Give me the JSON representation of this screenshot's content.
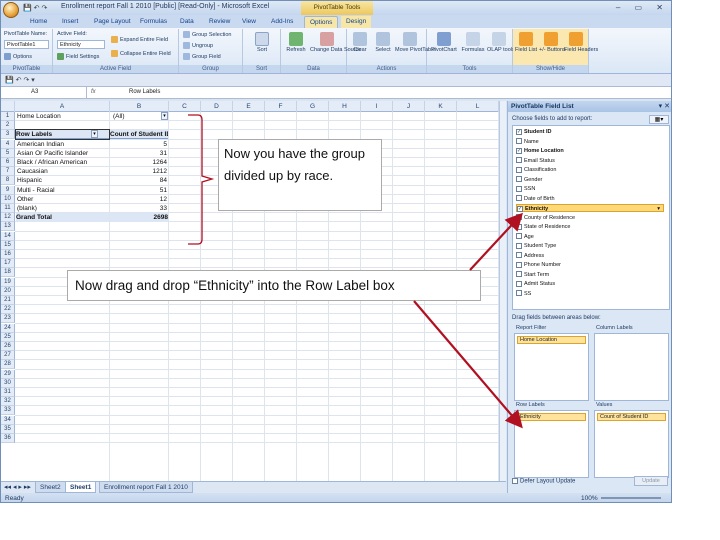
{
  "window": {
    "title": "Enrollment report Fall 1 2010 [Public] [Read-Only] - Microsoft Excel",
    "context_tab_title": "PivotTable Tools",
    "controls": "– ▭ ✕"
  },
  "ribbon_tabs": [
    "Home",
    "Insert",
    "Page Layout",
    "Formulas",
    "Data",
    "Review",
    "View",
    "Add-Ins",
    "Options",
    "Design"
  ],
  "ribbon": {
    "pivottable": {
      "name_label": "PivotTable Name:",
      "name_value": "PivotTable1",
      "options": "Options",
      "group": "PivotTable"
    },
    "active_field": {
      "label": "Active Field:",
      "value": "Ethnicity",
      "settings": "Field Settings",
      "expand": "Expand Entire Field",
      "collapse": "Collapse Entire Field",
      "group": "Active Field"
    },
    "group_grp": {
      "selection": "Group Selection",
      "ungroup": "Ungroup",
      "field": "Group Field",
      "group": "Group"
    },
    "sort": {
      "label": "Sort",
      "group": "Sort"
    },
    "data": {
      "refresh": "Refresh",
      "change_source": "Change Data Source",
      "group": "Data"
    },
    "actions": {
      "clear": "Clear",
      "select": "Select",
      "move": "Move PivotTable",
      "group": "Actions"
    },
    "tools": {
      "pivotchart": "PivotChart",
      "formulas": "Formulas",
      "olap": "OLAP tools",
      "group": "Tools"
    },
    "showhide": {
      "field_list": "Field List",
      "buttons": "+/- Buttons",
      "headers": "Field Headers",
      "group": "Show/Hide"
    }
  },
  "formula_bar": {
    "name_box": "A3",
    "fx": "fx",
    "value": "Row Labels"
  },
  "columns": [
    "A",
    "B",
    "C",
    "D",
    "E",
    "F",
    "G",
    "H",
    "I",
    "J",
    "K",
    "L"
  ],
  "rows": [
    "1",
    "2",
    "3",
    "4",
    "5",
    "6",
    "7",
    "8",
    "9",
    "10",
    "11",
    "12",
    "13",
    "14",
    "15",
    "16",
    "17",
    "18",
    "19",
    "20",
    "21",
    "22",
    "23",
    "24",
    "25",
    "26",
    "27",
    "28",
    "29",
    "30",
    "31",
    "32",
    "33",
    "34",
    "35",
    "36"
  ],
  "pivot": {
    "filter_label": "Home Location",
    "filter_value": "(All)",
    "row_header": "Row Labels",
    "value_header": "Count of Student ID",
    "rows": [
      {
        "label": "American Indian",
        "value": "5"
      },
      {
        "label": "Asian Or Pacific Islander",
        "value": "31"
      },
      {
        "label": "Black / African American",
        "value": "1264"
      },
      {
        "label": "Caucasian",
        "value": "1212"
      },
      {
        "label": "Hispanic",
        "value": "84"
      },
      {
        "label": "Multi - Racial",
        "value": "51"
      },
      {
        "label": "Other",
        "value": "12"
      },
      {
        "label": "(blank)",
        "value": "33"
      }
    ],
    "total_label": "Grand Total",
    "total_value": "2698"
  },
  "sheet_tabs": [
    "Sheet2",
    "Sheet1",
    "Enrollment report Fall 1 2010"
  ],
  "status": {
    "left": "Ready",
    "zoom": "100%"
  },
  "field_pane": {
    "title": "PivotTable Field List",
    "choose_label": "Choose fields to add to report:",
    "fields": [
      {
        "name": "Student ID",
        "checked": true
      },
      {
        "name": "Name",
        "checked": false
      },
      {
        "name": "Home Location",
        "checked": true
      },
      {
        "name": "Email Status",
        "checked": false
      },
      {
        "name": "Classification",
        "checked": false
      },
      {
        "name": "Gender",
        "checked": false
      },
      {
        "name": "SSN",
        "checked": false
      },
      {
        "name": "Date of Birth",
        "checked": false
      },
      {
        "name": "Ethnicity",
        "checked": true
      },
      {
        "name": "County of Residence",
        "checked": false
      },
      {
        "name": "State of Residence",
        "checked": false
      },
      {
        "name": "Age",
        "checked": false
      },
      {
        "name": "Student Type",
        "checked": false
      },
      {
        "name": "Address",
        "checked": false
      },
      {
        "name": "Phone Number",
        "checked": false
      },
      {
        "name": "Start Term",
        "checked": false
      },
      {
        "name": "Admit Status",
        "checked": false
      },
      {
        "name": "SS",
        "checked": false
      }
    ],
    "drag_label": "Drag fields between areas below:",
    "report_filter_title": "Report Filter",
    "report_filter_chip": "Home Location",
    "column_labels_title": "Column Labels",
    "row_labels_title": "Row Labels",
    "row_labels_chip": "Ethnicity",
    "values_title": "Values",
    "values_chip": "Count of Student ID",
    "defer_label": "Defer Layout Update",
    "update_label": "Update"
  },
  "callouts": {
    "grouped": "Now you have the group divided up by race.",
    "drag": "Now drag and drop “Ethnicity” into the Row Label box"
  },
  "arrow_color": "#b01020"
}
